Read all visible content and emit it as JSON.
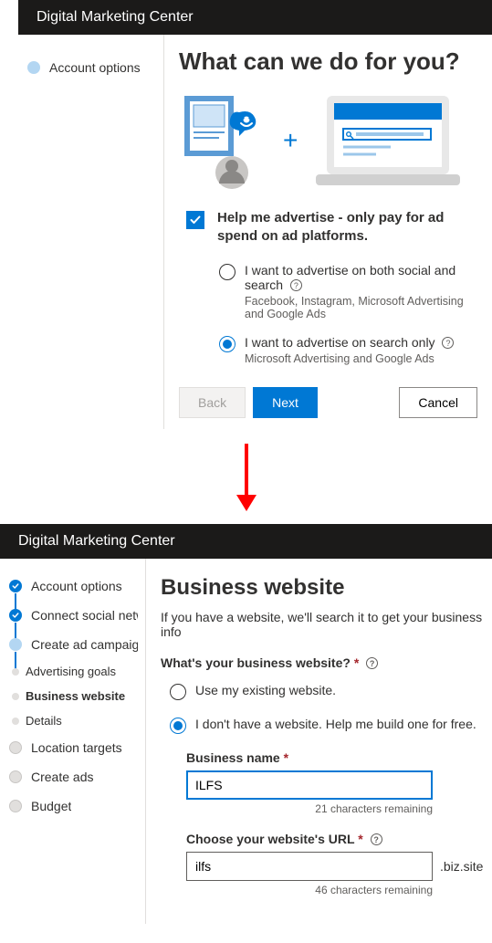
{
  "colors": {
    "brand": "#0078d4",
    "headerBg": "#1b1a19"
  },
  "screen1": {
    "headerTitle": "Digital Marketing Center",
    "sidebar": {
      "items": [
        {
          "label": "Account options",
          "state": "active"
        }
      ]
    },
    "pageTitle": "What can we do for you?",
    "helpAdvertise": {
      "checked": true,
      "label": "Help me advertise - only pay for ad spend on ad platforms."
    },
    "radios": [
      {
        "label": "I want to advertise on both social and search",
        "sub": "Facebook, Instagram, Microsoft Advertising and Google Ads",
        "selected": false
      },
      {
        "label": "I want to advertise on search only",
        "sub": "Microsoft Advertising and Google Ads",
        "selected": true
      }
    ],
    "buttons": {
      "back": "Back",
      "next": "Next",
      "cancel": "Cancel"
    }
  },
  "screen2": {
    "headerTitle": "Digital Marketing Center",
    "sidebar": {
      "steps": [
        {
          "label": "Account options",
          "state": "done"
        },
        {
          "label": "Connect social netw",
          "state": "done"
        },
        {
          "label": "Create ad campaign",
          "state": "active",
          "children": [
            {
              "label": "Advertising goals",
              "current": false
            },
            {
              "label": "Business website",
              "current": true
            },
            {
              "label": "Details",
              "current": false
            }
          ]
        },
        {
          "label": "Location targets",
          "state": "pending"
        },
        {
          "label": "Create ads",
          "state": "pending"
        },
        {
          "label": "Budget",
          "state": "pending"
        }
      ]
    },
    "pageTitle": "Business website",
    "lede": "If you have a website, we'll search it to get your business info",
    "question": "What's your business website?",
    "radios": [
      {
        "label": "Use my existing website.",
        "selected": false
      },
      {
        "label": "I don't have a website. Help me build one for free.",
        "selected": true
      }
    ],
    "businessName": {
      "label": "Business name",
      "value": "ILFS",
      "hint": "21 characters remaining"
    },
    "websiteUrl": {
      "label": "Choose your website's URL",
      "value": "ilfs",
      "suffix": ".biz.site",
      "hint": "46 characters remaining"
    }
  }
}
